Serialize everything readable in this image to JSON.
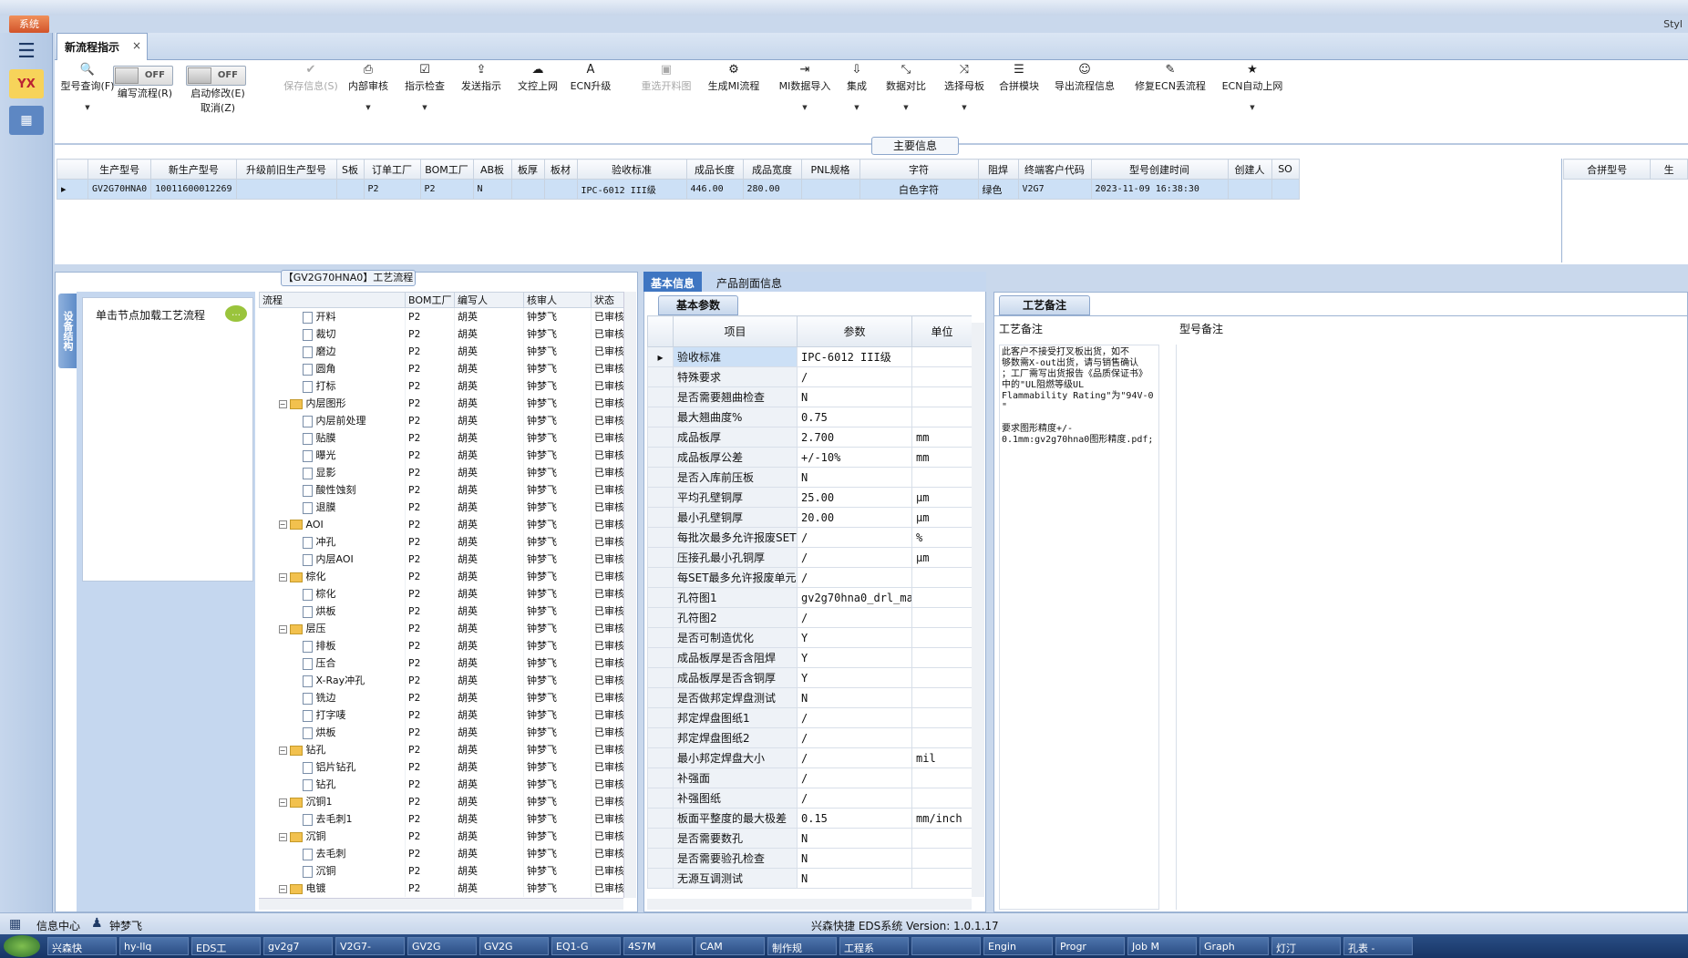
{
  "top": {
    "system_btn": "系统",
    "style_text": "Styl"
  },
  "tab": {
    "label": "新流程指示",
    "close": "×"
  },
  "toolbar": {
    "query": "型号查询(F)",
    "edit_flow": "编写流程(R)",
    "start_edit": "启动修改(E)",
    "cancel": "取消(Z)",
    "toggle_off": "OFF",
    "save": "保存信息(S)",
    "internal_review": "内部审核",
    "instruction_check": "指示检查",
    "send_instruction": "发送指示",
    "doc_upload": "文控上网",
    "ecn_upgrade": "ECN升级",
    "reselect_chart": "重选开料图",
    "gen_mi": "生成MI流程",
    "mi_import": "MI数据导入",
    "integrate": "集成",
    "data_compare": "数据对比",
    "select_mother": "选择母板",
    "merge_module": "合拼模块",
    "export_flow": "导出流程信息",
    "fix_ecn": "修复ECN丢流程",
    "ecn_auto": "ECN自动上网"
  },
  "main_info": {
    "title": "主要信息",
    "columns": [
      "生产型号",
      "新生产型号",
      "升级前旧生产型号",
      "S板",
      "订单工厂",
      "BOM工厂",
      "AB板",
      "板厚",
      "板材",
      "验收标准",
      "成品长度",
      "成品宽度",
      "PNL规格",
      "字符",
      "阻焊",
      "终端客户代码",
      "型号创建时间",
      "创建人",
      "SO"
    ],
    "row": [
      "GV2G70HNA0",
      "10011600012269",
      "",
      "",
      "P2",
      "P2",
      "N",
      "",
      "",
      "IPC-6012 III级",
      "446.00",
      "280.00",
      "",
      "白色字符",
      "绿色",
      "V2G7",
      "2023-11-09 16:38:30",
      "",
      ""
    ],
    "right_columns": [
      "合拼型号",
      "生"
    ]
  },
  "flow": {
    "title": "【GV2G70HNA0】工艺流程",
    "vtab": "设备结构",
    "node_hint": "单击节点加载工艺流程",
    "columns": [
      "流程",
      "BOM工厂",
      "编写人",
      "核审人",
      "状态"
    ],
    "rows": [
      {
        "name": "开料",
        "folder": false,
        "lvl": 2,
        "bom": "P2",
        "w": "胡英",
        "r": "钟梦飞",
        "s": "已审核"
      },
      {
        "name": "裁切",
        "folder": false,
        "lvl": 2,
        "bom": "P2",
        "w": "胡英",
        "r": "钟梦飞",
        "s": "已审核"
      },
      {
        "name": "磨边",
        "folder": false,
        "lvl": 2,
        "bom": "P2",
        "w": "胡英",
        "r": "钟梦飞",
        "s": "已审核"
      },
      {
        "name": "圆角",
        "folder": false,
        "lvl": 2,
        "bom": "P2",
        "w": "胡英",
        "r": "钟梦飞",
        "s": "已审核"
      },
      {
        "name": "打标",
        "folder": false,
        "lvl": 2,
        "bom": "P2",
        "w": "胡英",
        "r": "钟梦飞",
        "s": "已审核"
      },
      {
        "name": "内层图形",
        "folder": true,
        "lvl": 1,
        "bom": "P2",
        "w": "胡英",
        "r": "钟梦飞",
        "s": "已审核"
      },
      {
        "name": "内层前处理",
        "folder": false,
        "lvl": 2,
        "bom": "P2",
        "w": "胡英",
        "r": "钟梦飞",
        "s": "已审核"
      },
      {
        "name": "贴膜",
        "folder": false,
        "lvl": 2,
        "bom": "P2",
        "w": "胡英",
        "r": "钟梦飞",
        "s": "已审核"
      },
      {
        "name": "曝光",
        "folder": false,
        "lvl": 2,
        "bom": "P2",
        "w": "胡英",
        "r": "钟梦飞",
        "s": "已审核"
      },
      {
        "name": "显影",
        "folder": false,
        "lvl": 2,
        "bom": "P2",
        "w": "胡英",
        "r": "钟梦飞",
        "s": "已审核"
      },
      {
        "name": "酸性蚀刻",
        "folder": false,
        "lvl": 2,
        "bom": "P2",
        "w": "胡英",
        "r": "钟梦飞",
        "s": "已审核"
      },
      {
        "name": "退膜",
        "folder": false,
        "lvl": 2,
        "bom": "P2",
        "w": "胡英",
        "r": "钟梦飞",
        "s": "已审核"
      },
      {
        "name": "AOI",
        "folder": true,
        "lvl": 1,
        "bom": "P2",
        "w": "胡英",
        "r": "钟梦飞",
        "s": "已审核"
      },
      {
        "name": "冲孔",
        "folder": false,
        "lvl": 2,
        "bom": "P2",
        "w": "胡英",
        "r": "钟梦飞",
        "s": "已审核"
      },
      {
        "name": "内层AOI",
        "folder": false,
        "lvl": 2,
        "bom": "P2",
        "w": "胡英",
        "r": "钟梦飞",
        "s": "已审核"
      },
      {
        "name": "棕化",
        "folder": true,
        "lvl": 1,
        "bom": "P2",
        "w": "胡英",
        "r": "钟梦飞",
        "s": "已审核"
      },
      {
        "name": "棕化",
        "folder": false,
        "lvl": 2,
        "bom": "P2",
        "w": "胡英",
        "r": "钟梦飞",
        "s": "已审核"
      },
      {
        "name": "烘板",
        "folder": false,
        "lvl": 2,
        "bom": "P2",
        "w": "胡英",
        "r": "钟梦飞",
        "s": "已审核"
      },
      {
        "name": "层压",
        "folder": true,
        "lvl": 1,
        "bom": "P2",
        "w": "胡英",
        "r": "钟梦飞",
        "s": "已审核"
      },
      {
        "name": "排板",
        "folder": false,
        "lvl": 2,
        "bom": "P2",
        "w": "胡英",
        "r": "钟梦飞",
        "s": "已审核"
      },
      {
        "name": "压合",
        "folder": false,
        "lvl": 2,
        "bom": "P2",
        "w": "胡英",
        "r": "钟梦飞",
        "s": "已审核"
      },
      {
        "name": "X-Ray冲孔",
        "folder": false,
        "lvl": 2,
        "bom": "P2",
        "w": "胡英",
        "r": "钟梦飞",
        "s": "已审核"
      },
      {
        "name": "铣边",
        "folder": false,
        "lvl": 2,
        "bom": "P2",
        "w": "胡英",
        "r": "钟梦飞",
        "s": "已审核"
      },
      {
        "name": "打字唛",
        "folder": false,
        "lvl": 2,
        "bom": "P2",
        "w": "胡英",
        "r": "钟梦飞",
        "s": "已审核"
      },
      {
        "name": "烘板",
        "folder": false,
        "lvl": 2,
        "bom": "P2",
        "w": "胡英",
        "r": "钟梦飞",
        "s": "已审核"
      },
      {
        "name": "钻孔",
        "folder": true,
        "lvl": 1,
        "bom": "P2",
        "w": "胡英",
        "r": "钟梦飞",
        "s": "已审核"
      },
      {
        "name": "铝片钻孔",
        "folder": false,
        "lvl": 2,
        "bom": "P2",
        "w": "胡英",
        "r": "钟梦飞",
        "s": "已审核"
      },
      {
        "name": "钻孔",
        "folder": false,
        "lvl": 2,
        "bom": "P2",
        "w": "胡英",
        "r": "钟梦飞",
        "s": "已审核"
      },
      {
        "name": "沉铜1",
        "folder": true,
        "lvl": 1,
        "bom": "P2",
        "w": "胡英",
        "r": "钟梦飞",
        "s": "已审核"
      },
      {
        "name": "去毛刺1",
        "folder": false,
        "lvl": 2,
        "bom": "P2",
        "w": "胡英",
        "r": "钟梦飞",
        "s": "已审核"
      },
      {
        "name": "沉铜",
        "folder": true,
        "lvl": 1,
        "bom": "P2",
        "w": "胡英",
        "r": "钟梦飞",
        "s": "已审核"
      },
      {
        "name": "去毛刺",
        "folder": false,
        "lvl": 2,
        "bom": "P2",
        "w": "胡英",
        "r": "钟梦飞",
        "s": "已审核"
      },
      {
        "name": "沉铜",
        "folder": false,
        "lvl": 2,
        "bom": "P2",
        "w": "胡英",
        "r": "钟梦飞",
        "s": "已审核"
      },
      {
        "name": "电镀",
        "folder": true,
        "lvl": 1,
        "bom": "P2",
        "w": "胡英",
        "r": "钟梦飞",
        "s": "已审核"
      }
    ]
  },
  "basic": {
    "tabs": [
      "基本信息",
      "产品剖面信息"
    ],
    "section": "基本参数",
    "columns": [
      "项目",
      "参数",
      "单位"
    ],
    "rows": [
      [
        "验收标准",
        "IPC-6012 III级",
        ""
      ],
      [
        "特殊要求",
        "/",
        ""
      ],
      [
        "是否需要翘曲检查",
        "N",
        ""
      ],
      [
        "最大翘曲度%",
        "0.75",
        ""
      ],
      [
        "成品板厚",
        "2.700",
        "mm"
      ],
      [
        "成品板厚公差",
        "+/-10%",
        "mm"
      ],
      [
        "是否入库前压板",
        "N",
        ""
      ],
      [
        "平均孔壁铜厚",
        "25.00",
        "μm"
      ],
      [
        "最小孔壁铜厚",
        "20.00",
        "μm"
      ],
      [
        "每批次最多允许报废SET",
        "/",
        "%"
      ],
      [
        "压接孔最小孔铜厚",
        "/",
        "μm"
      ],
      [
        "每SET最多允许报废单元",
        "/",
        ""
      ],
      [
        "孔符图1",
        "gv2g70hna0_drl_ma...",
        ""
      ],
      [
        "孔符图2",
        "/",
        ""
      ],
      [
        "是否可制造优化",
        "Y",
        ""
      ],
      [
        "成品板厚是否含阻焊",
        "Y",
        ""
      ],
      [
        "成品板厚是否含铜厚",
        "Y",
        ""
      ],
      [
        "是否做邦定焊盘测试",
        "N",
        ""
      ],
      [
        "邦定焊盘图纸1",
        "/",
        ""
      ],
      [
        "邦定焊盘图纸2",
        "/",
        ""
      ],
      [
        "最小邦定焊盘大小",
        "/",
        "mil"
      ],
      [
        "补强面",
        "/",
        ""
      ],
      [
        "补强图纸",
        "/",
        ""
      ],
      [
        "板面平整度的最大极差",
        "0.15",
        "mm/inch"
      ],
      [
        "是否需要数孔",
        "N",
        ""
      ],
      [
        "是否需要验孔检查",
        "N",
        ""
      ],
      [
        "无源互调测试",
        "N",
        ""
      ]
    ]
  },
  "notes": {
    "section": "工艺备注",
    "note_label": "工艺备注",
    "type_label": "型号备注",
    "note_text": "此客户不接受打叉板出货，如不\n够数需X-out出货，请与销售确认\n；工厂需写出货报告《品质保证书》\n中的\"UL阻燃等级UL\nFlammability Rating\"为\"94V-0\n\"\n\n要求图形精度+/-\n0.1mm:gv2g70hna0图形精度.pdf;"
  },
  "status": {
    "info_center": "信息中心",
    "user": "钟梦飞",
    "system": "兴森快捷 EDS系统 Version: 1.0.1.17"
  },
  "taskbar": [
    "兴森快",
    "hy-llq",
    "EDS工",
    "gv2g7",
    "V2G7-",
    "GV2G",
    "GV2G",
    "EQ1-G",
    "4S7M",
    "CAM",
    "制作规",
    "工程系",
    "",
    "Engin",
    "Progr",
    "Job M",
    "Graph",
    "灯汀",
    "孔表 -"
  ]
}
